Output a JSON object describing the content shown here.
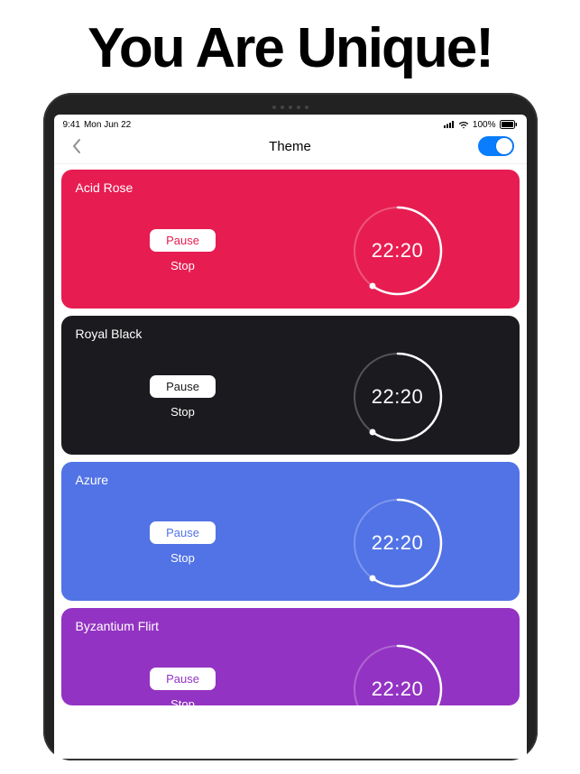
{
  "headline": "You Are Unique!",
  "status": {
    "time": "9:41",
    "date": "Mon Jun 22",
    "battery_pct": "100%"
  },
  "nav": {
    "title": "Theme",
    "toggle_on": true
  },
  "common": {
    "pause_label": "Pause",
    "stop_label": "Stop",
    "time_value": "22:20"
  },
  "themes": [
    {
      "name": "Acid Rose",
      "bg": "#e71d51",
      "btn_text": "#e71d51"
    },
    {
      "name": "Royal Black",
      "bg": "#1b1b1f",
      "btn_text": "#1b1b1f"
    },
    {
      "name": "Azure",
      "bg": "#5273e6",
      "btn_text": "#5273e6"
    },
    {
      "name": "Byzantium Flirt",
      "bg": "#9333c3",
      "btn_text": "#9333c3"
    }
  ]
}
